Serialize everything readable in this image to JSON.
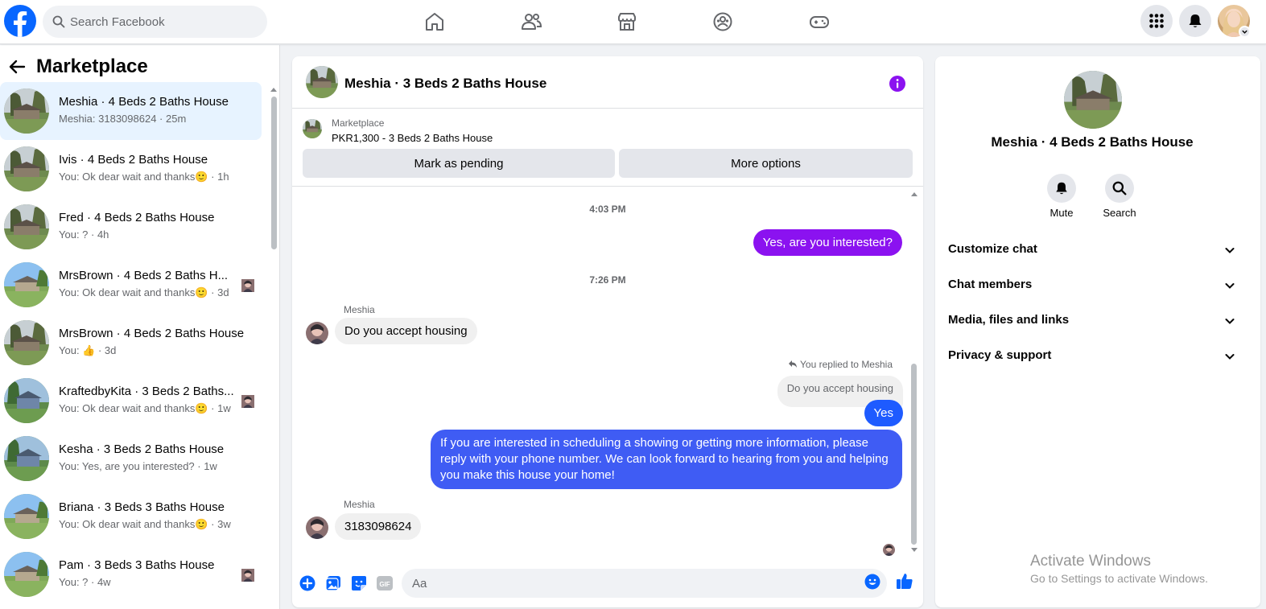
{
  "topbar": {
    "search_placeholder": "Search Facebook",
    "icons": [
      "facebook-logo",
      "search-icon",
      "home-icon",
      "friends-icon",
      "marketplace-icon",
      "groups-icon",
      "gaming-icon",
      "menu-grid-icon",
      "bell-icon",
      "chevron-down-icon"
    ],
    "accent": "#0866ff"
  },
  "sidebar": {
    "title": "Marketplace",
    "conversations": [
      {
        "title": "Meshia · 4 Beds 2 Baths House",
        "subtitle": "Meshia: 3183098624 · 25m",
        "active": true
      },
      {
        "title": "Ivis · 4 Beds 2 Baths House",
        "subtitle": "You: Ok dear wait and thanks🙂 · 1h"
      },
      {
        "title": "Fred · 4 Beds 2 Baths House",
        "subtitle": "You: ? · 4h"
      },
      {
        "title": "MrsBrown · 4 Beds 2 Baths H...",
        "subtitle": "You: Ok dear wait and thanks🙂 · 3d"
      },
      {
        "title": "MrsBrown · 4 Beds 2 Baths House",
        "subtitle": "You: 👍 · 3d"
      },
      {
        "title": "KraftedbyKita · 3 Beds 2 Baths...",
        "subtitle": "You: Ok dear wait and thanks🙂 · 1w"
      },
      {
        "title": "Kesha · 3 Beds 2 Baths House",
        "subtitle": "You: Yes, are you interested? · 1w"
      },
      {
        "title": "Briana · 3 Beds 3 Baths House",
        "subtitle": "You: Ok dear wait and thanks🙂 · 3w"
      },
      {
        "title": "Pam · 3 Beds 3 Baths House",
        "subtitle": "You: ? · 4w"
      }
    ]
  },
  "chat": {
    "title": "Meshia · 3 Beds 2 Baths House",
    "listing_label": "Marketplace",
    "listing_price": "PKR1,300 - 3 Beds 2 Baths House",
    "mark_pending_label": "Mark as pending",
    "more_options_label": "More options",
    "time1": "4:03 PM",
    "msg_out1": "Yes, are you interested?",
    "time2": "7:26 PM",
    "sender1": "Meshia",
    "msg_in1": "Do you accept housing",
    "reply_note": "You replied to Meshia",
    "reply_quote": "Do you accept housing",
    "msg_out2": "Yes",
    "msg_out3": "If you are interested in scheduling a showing or getting more information, please reply with your phone number. We can look forward to hearing from you and helping you make this house your home!",
    "sender2": "Meshia",
    "msg_in2": "3183098624",
    "input_placeholder": "Aa",
    "colors": {
      "outgoing": "#8b12f0",
      "outgoing_blue": "#1e5bff",
      "incoming": "#f0f0f0"
    }
  },
  "details": {
    "name": "Meshia · 4 Beds 2 Baths House",
    "mute_label": "Mute",
    "search_label": "Search",
    "sections": [
      "Customize chat",
      "Chat members",
      "Media, files and links",
      "Privacy & support"
    ]
  },
  "watermark": {
    "line1": "Activate Windows",
    "line2": "Go to Settings to activate Windows."
  }
}
